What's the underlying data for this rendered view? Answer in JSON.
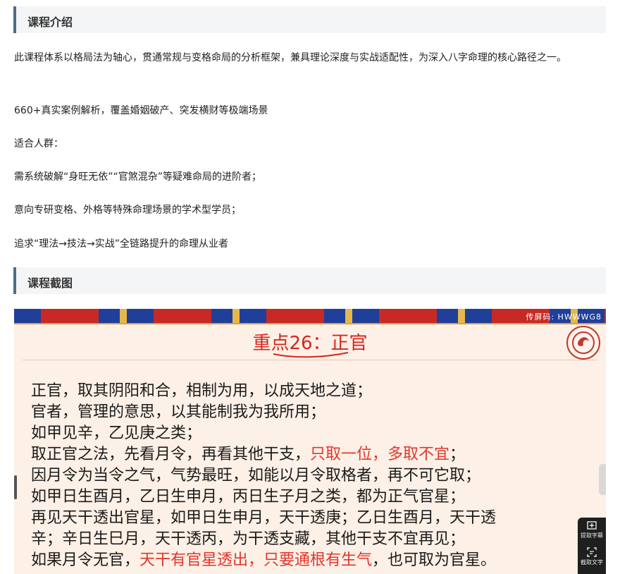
{
  "sections": {
    "intro_title": "课程介绍",
    "screenshot_title": "课程截图"
  },
  "intro": {
    "p1": "此课程体系以格局法为轴心，贯通常规与变格命局的分析框架，兼具理论深度与实战适配性，为深入八字命理的核心路径之一。",
    "p2": "660+真实案例解析，覆盖婚姻破产、突发横财等极端场景",
    "p3": "适合人群：",
    "p4": "需系统破解“身旺无依”“官煞混杂”等疑难命局的进阶者；",
    "p5": "意向专研变格、外格等特殊命理场景的学术型学员；",
    "p6": "追求“理法→技法→实战”全链路提升的命理从业者"
  },
  "slide": {
    "code": "传屏码: HWWWG8",
    "title": "重点26：正官",
    "lines": [
      {
        "a": "正官，取其阴阳和合，相制为用，以成天地之道；",
        "r": "",
        "b": ""
      },
      {
        "a": "官者，管理的意思，以其能制我为我所用；",
        "r": "",
        "b": ""
      },
      {
        "a": "如甲见辛，乙见庚之类；",
        "r": "",
        "b": ""
      },
      {
        "a": "取正官之法，先看月令，再看其他干支，",
        "r": "只取一位，多取不宜",
        "b": "；"
      },
      {
        "a": "因月令为当令之气，气势最旺，如能以月令取格者，再不可它取；",
        "r": "",
        "b": ""
      },
      {
        "a": "如甲日生酉月，乙日生申月，丙日生子月之类，都为正气官星；",
        "r": "",
        "b": ""
      },
      {
        "a": "再见天干透出官星，如甲日生申月，天干透庚；乙日生酉月，天干透",
        "r": "",
        "b": ""
      },
      {
        "a": "辛；辛日生巳月，天干透丙，为干透支藏，其他干支不宜再见；",
        "r": "",
        "b": ""
      },
      {
        "a": "如果月令无官，",
        "r": "天干有官星透出，只要通根有生气",
        "b": "，也可取为官星。"
      }
    ]
  },
  "side_tools": {
    "subtitle_label": "提取字幕",
    "text_label": "截取文字"
  },
  "colors": {
    "accent_red": "#d9251d",
    "section_bar": "#4f6d8a"
  }
}
